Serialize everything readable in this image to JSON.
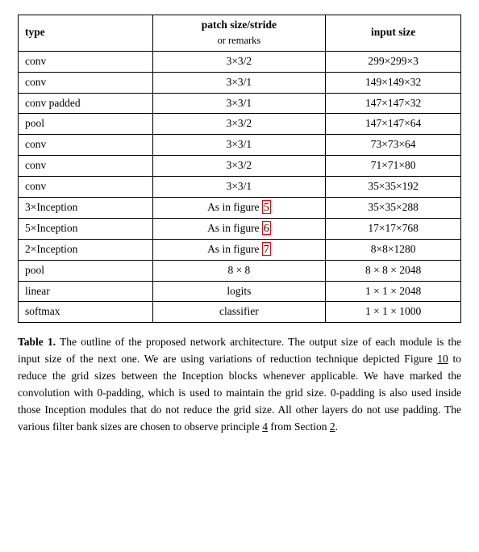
{
  "table": {
    "headers": {
      "col1": "type",
      "col2_main": "patch size/stride",
      "col2_sub": "or remarks",
      "col3": "input size"
    },
    "rows": [
      {
        "type": "conv",
        "patch": "3×3/2",
        "input": "299×299×3"
      },
      {
        "type": "conv",
        "patch": "3×3/1",
        "input": "149×149×32"
      },
      {
        "type": "conv padded",
        "patch": "3×3/1",
        "input": "147×147×32"
      },
      {
        "type": "pool",
        "patch": "3×3/2",
        "input": "147×147×64"
      },
      {
        "type": "conv",
        "patch": "3×3/1",
        "input": "73×73×64"
      },
      {
        "type": "conv",
        "patch": "3×3/2",
        "input": "71×71×80"
      },
      {
        "type": "conv",
        "patch": "3×3/1",
        "input": "35×35×192"
      },
      {
        "type": "3×Inception",
        "patch": "As in figure 5",
        "input": "35×35×288",
        "fig_ref": "5",
        "has_ref": true
      },
      {
        "type": "5×Inception",
        "patch": "As in figure 6",
        "input": "17×17×768",
        "fig_ref": "6",
        "has_ref": true
      },
      {
        "type": "2×Inception",
        "patch": "As in figure 7",
        "input": "8×8×1280",
        "fig_ref": "7",
        "has_ref": true
      },
      {
        "type": "pool",
        "patch": "8 × 8",
        "input": "8 × 8 × 2048"
      },
      {
        "type": "linear",
        "patch": "logits",
        "input": "1 × 1 × 2048"
      },
      {
        "type": "softmax",
        "patch": "classifier",
        "input": "1 × 1 × 1000"
      }
    ]
  },
  "caption": {
    "label": "Table 1.",
    "text": " The outline of the proposed network architecture.  The output size of each module is the input size of the next one.  We are using variations of reduction technique depicted Figure ",
    "ref10": "10",
    "text2": " to reduce the grid sizes between the Inception blocks whenever applicable.  We have marked the convolution with 0-padding, which is used to maintain the grid size.  0-padding is also used inside those Inception modules that do not reduce the grid size.  All other layers do not use padding.  The various filter bank sizes are chosen to observe principle ",
    "ref4": "4",
    "text3": " from Section ",
    "ref2": "2",
    "text4": "."
  }
}
